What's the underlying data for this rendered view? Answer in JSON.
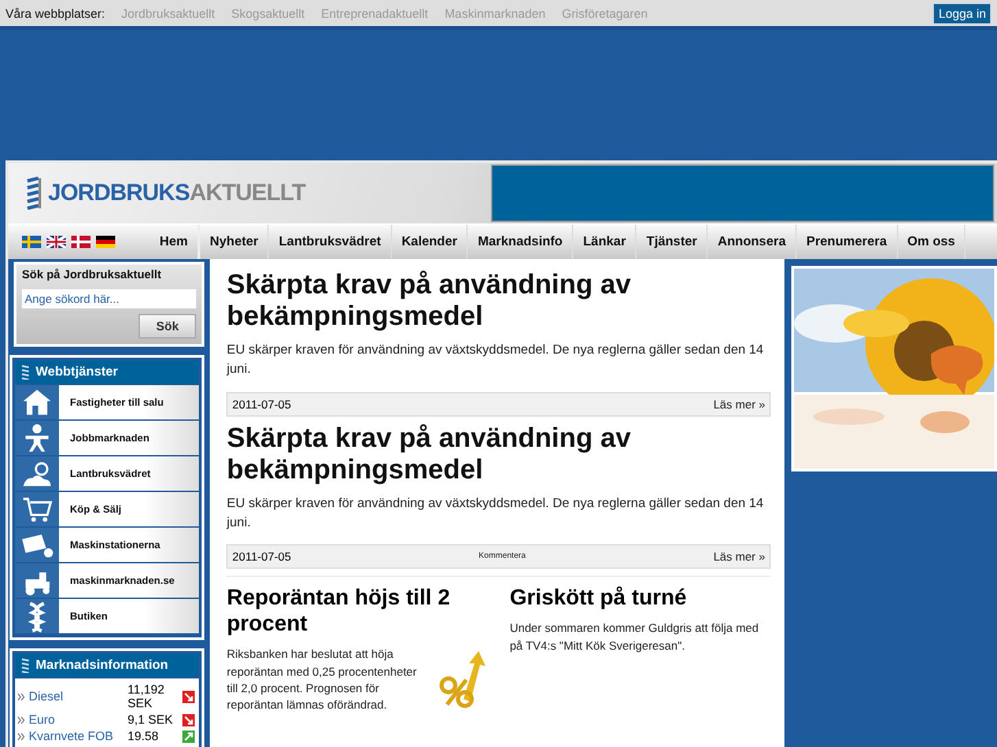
{
  "topbar": {
    "label": "Våra webbplatser:",
    "sites": [
      "Jordbruksaktuellt",
      "Skogsaktuellt",
      "Entreprenadaktuellt",
      "Maskinmarknaden",
      "Grisföretagaren"
    ],
    "login": "Logga in"
  },
  "logo": {
    "part1": "JORDBRUKS",
    "part2": "AKTUELLT"
  },
  "nav": {
    "home": "Hem",
    "items": [
      "Nyheter",
      "Lantbruksvädret",
      "Kalender",
      "Marknadsinfo",
      "Länkar",
      "Tjänster",
      "Annonsera",
      "Prenumerera",
      "Om oss"
    ]
  },
  "search": {
    "title": "Sök på Jordbruksaktuellt",
    "placeholder": "Ange sökord här...",
    "button": "Sök"
  },
  "services": {
    "title": "Webbtjänster",
    "items": [
      {
        "label": "Fastigheter till salu",
        "kind": "house"
      },
      {
        "label": "Jobbmarknaden",
        "kind": "person"
      },
      {
        "label": "Lantbruksvädret",
        "kind": "weather"
      },
      {
        "label": "Köp & Sälj",
        "kind": "cart"
      },
      {
        "label": "Maskinstationerna",
        "kind": "machine"
      },
      {
        "label": "maskinmarknaden.se",
        "kind": "tractor"
      },
      {
        "label": "Butiken",
        "kind": "shop"
      }
    ]
  },
  "market": {
    "title": "Marknadsinformation",
    "rows": [
      {
        "name": "Diesel",
        "value": "11,192 SEK",
        "kind": "down"
      },
      {
        "name": "Euro",
        "value": "9,1 SEK",
        "kind": "down"
      },
      {
        "name": "Kvarnvete FOB",
        "value": "19.58",
        "kind": "up"
      }
    ]
  },
  "articles": [
    {
      "title": "Skärpta krav på användning av bekämpningsmedel",
      "text": "EU skärper kraven för användning av växtskyddsmedel. De nya reglerna gäller sedan den 14 juni.",
      "date": "2011-07-05",
      "read_more": "Läs mer »"
    },
    {
      "title": "Skärpta krav på användning av bekämpningsmedel",
      "text": "EU skärper kraven för användning av växtskyddsmedel. De nya reglerna gäller sedan den 14 juni.",
      "date": "2011-07-05",
      "comment": "Kommentera",
      "read_more": "Läs mer »"
    }
  ],
  "small_articles": [
    {
      "title": "Reporäntan höjs till 2 procent",
      "text": "Riksbanken har beslutat att höja reporäntan med 0,25 procentenheter till 2,0 procent. Prognosen för reporäntan lämnas oförändrad.",
      "kind": "with_icon"
    },
    {
      "title": "Griskött på turné",
      "text": "Under sommaren kommer Guldgris att följa med på TV4:s \"Mitt Kök Sverigeresan\".",
      "kind": "text"
    }
  ]
}
